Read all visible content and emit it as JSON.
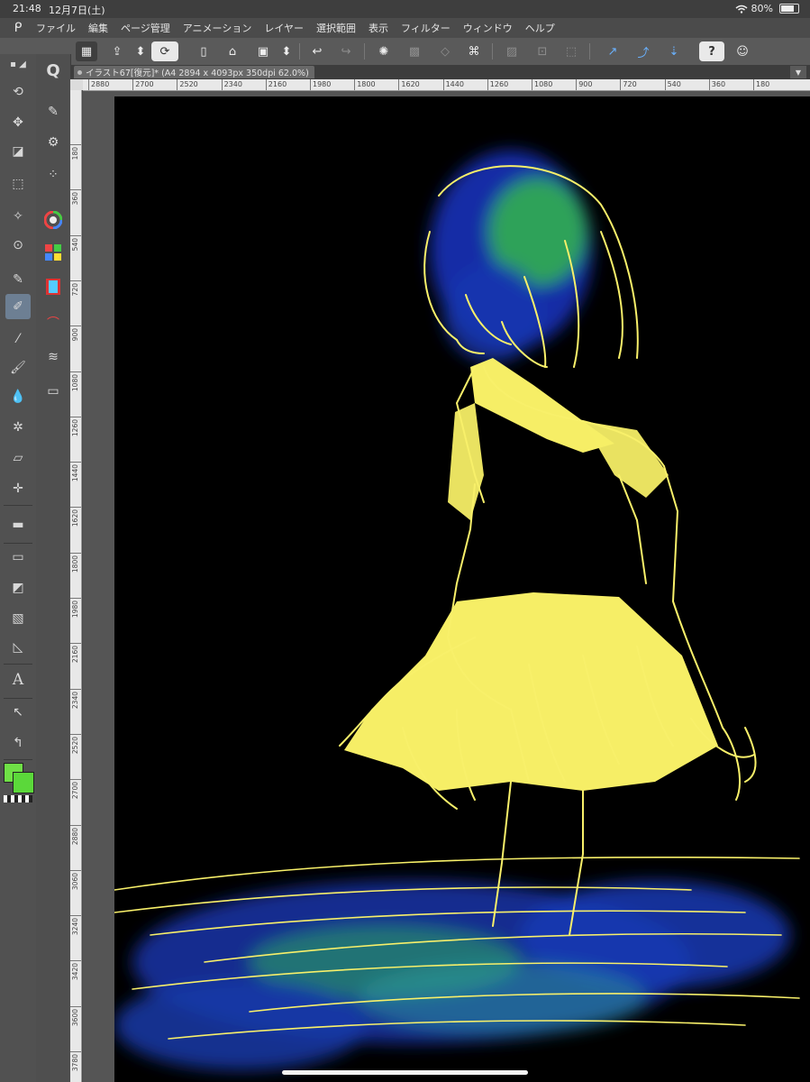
{
  "status": {
    "time": "21:48",
    "date": "12月7日(土)",
    "battery": "80%",
    "battery_level": 0.8
  },
  "menu": {
    "items": [
      "ファイル",
      "編集",
      "ページ管理",
      "アニメーション",
      "レイヤー",
      "選択範囲",
      "表示",
      "フィルター",
      "ウィンドウ",
      "ヘルプ"
    ]
  },
  "document": {
    "tab_title": "イラスト67[復元]* (A4 2894 x 4093px 350dpi 62.0%)"
  },
  "ruler": {
    "horizontal": [
      "2880",
      "2700",
      "2520",
      "2340",
      "2160",
      "1980",
      "1800",
      "1620",
      "1440",
      "1260",
      "1080",
      "900",
      "720",
      "540",
      "360",
      "180"
    ],
    "vertical": [
      "180",
      "360",
      "540",
      "720",
      "900",
      "1080",
      "1260",
      "1440",
      "1620",
      "1800",
      "1980",
      "2160",
      "2340",
      "2520",
      "2700",
      "2880",
      "3060",
      "3240",
      "3420",
      "3600",
      "3780"
    ]
  },
  "toolbar": {
    "help_label": "?"
  },
  "tools": {
    "text_tool_label": "A"
  },
  "colors": {
    "main": "#6fe046",
    "sub": "#5bd83a",
    "line_art": "#f8f06a",
    "canvas_bg": "#000000",
    "glow_green": "#3bd24a",
    "glow_blue": "#1a3cc8"
  }
}
